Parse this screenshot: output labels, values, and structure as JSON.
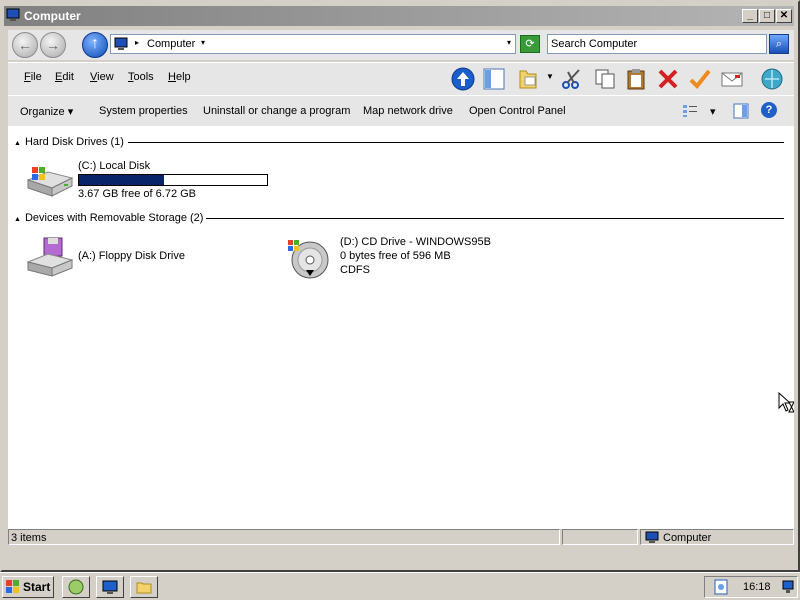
{
  "window": {
    "title": "Computer",
    "minimize_glyph": "_",
    "maximize_glyph": "□",
    "close_glyph": "✕"
  },
  "address": {
    "back_glyph": "←",
    "forward_glyph": "→",
    "up_glyph": "↑",
    "separator_glyph": "▸",
    "path": "Computer",
    "dropdown_glyph": "▾",
    "refresh_glyph": "⟳",
    "search_placeholder": "Search Computer",
    "search_glyph": "⌕"
  },
  "menu": {
    "items": [
      {
        "label": "File",
        "key": "F"
      },
      {
        "label": "Edit",
        "key": "E"
      },
      {
        "label": "View",
        "key": "V"
      },
      {
        "label": "Tools",
        "key": "T"
      },
      {
        "label": "Help",
        "key": "H"
      }
    ],
    "toolbar_icons": [
      "up-icon",
      "folders-pane-icon",
      "folder-options-icon",
      "cut-icon",
      "copy-icon",
      "paste-icon",
      "delete-icon",
      "properties-check-icon",
      "email-icon",
      "globe-icon"
    ]
  },
  "commands": {
    "organize": "Organize",
    "system_properties": "System properties",
    "uninstall": "Uninstall or change a program",
    "map_drive": "Map network drive",
    "control_panel": "Open Control Panel",
    "dropdown_glyph": "▾",
    "help_glyph": "?"
  },
  "groups": [
    {
      "header": "Hard Disk Drives (1)",
      "drives": [
        {
          "name": "(C:) Local Disk",
          "free": "3.67 GB free of 6.72 GB",
          "used_fraction": 0.454
        }
      ]
    },
    {
      "header": "Devices with Removable Storage (2)",
      "drives": [
        {
          "name": "(A:) Floppy Disk Drive"
        },
        {
          "name": "(D:) CD Drive - WINDOWS95B",
          "free": "0 bytes free of 596 MB",
          "fs": "CDFS"
        }
      ]
    }
  ],
  "status": {
    "items": "3 items",
    "location": "Computer"
  },
  "taskbar": {
    "start": "Start",
    "clock": "16:18"
  },
  "colors": {
    "capacity_fill": "#0a246a",
    "title_gradient_start": "#808080"
  }
}
